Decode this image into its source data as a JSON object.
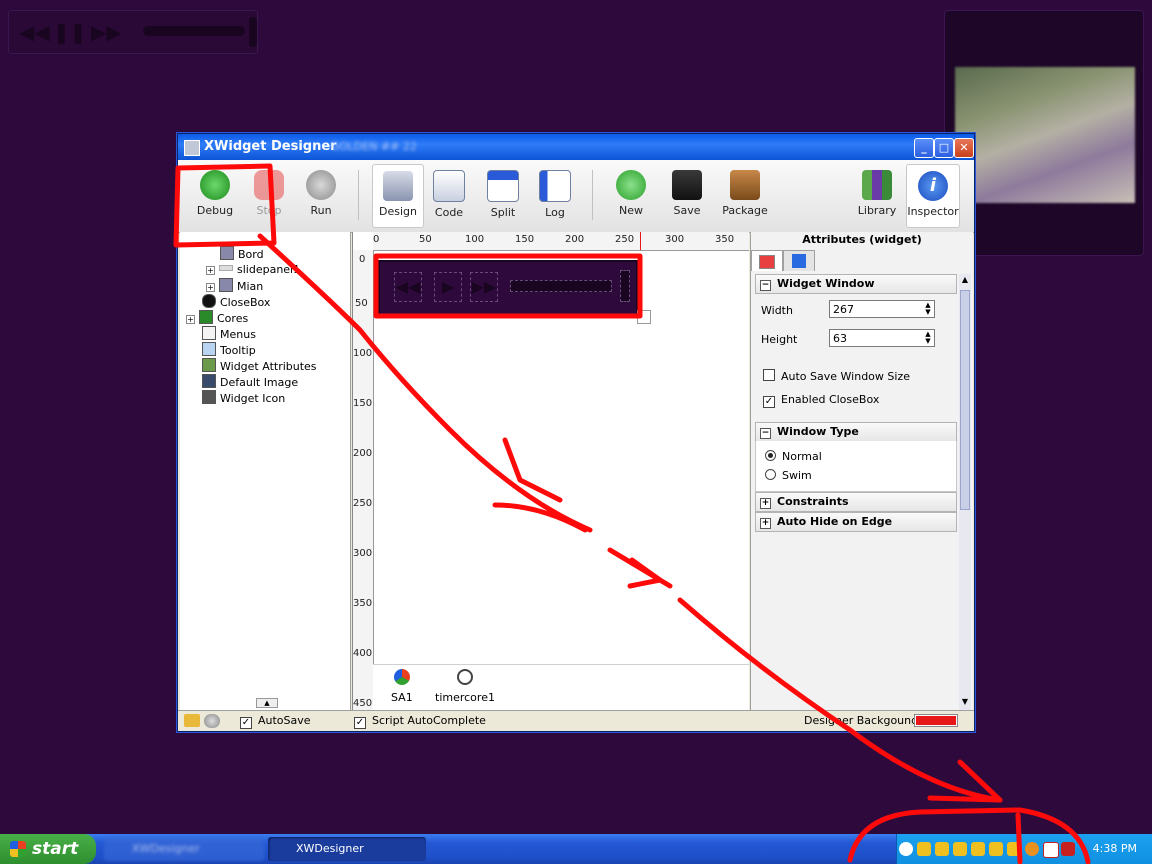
{
  "window": {
    "title": "XWidget Designer",
    "subtitle_blurred": "- GOLDEN ## 22"
  },
  "toolbar": {
    "debug": "Debug",
    "stop": "Stop",
    "run": "Run",
    "design": "Design",
    "code": "Code",
    "split": "Split",
    "log": "Log",
    "new": "New",
    "save": "Save",
    "package": "Package",
    "library": "Library",
    "inspector": "Inspector"
  },
  "tree": {
    "items": [
      {
        "label": "Bord"
      },
      {
        "label": "slidepanel1"
      },
      {
        "label": "Mian"
      },
      {
        "label": "CloseBox"
      },
      {
        "label": "Cores"
      },
      {
        "label": "Menus"
      },
      {
        "label": "Tooltip"
      },
      {
        "label": "Widget Attributes"
      },
      {
        "label": "Default Image"
      },
      {
        "label": "Widget Icon"
      }
    ]
  },
  "ruler": {
    "h": [
      "0",
      "50",
      "100",
      "150",
      "200",
      "250",
      "300",
      "350"
    ],
    "v": [
      "0",
      "50",
      "100",
      "150",
      "200",
      "250",
      "300",
      "350",
      "400",
      "450"
    ]
  },
  "components": [
    {
      "label": "SA1"
    },
    {
      "label": "timercore1"
    }
  ],
  "inspector": {
    "title": "Attributes (widget)",
    "widget_window": "Widget Window",
    "width_label": "Width",
    "width_value": "267",
    "height_label": "Height",
    "height_value": "63",
    "auto_save_size": "Auto Save Window Size",
    "auto_save_size_checked": false,
    "enabled_closebox": "Enabled CloseBox",
    "enabled_closebox_checked": true,
    "window_type": "Window Type",
    "normal": "Normal",
    "swim": "Swim",
    "selected_type": "Normal",
    "constraints": "Constraints",
    "auto_hide": "Auto Hide on Edge"
  },
  "statusbar": {
    "autosave": "AutoSave",
    "script_autocomplete": "Script AutoComplete",
    "designer_background": "Designer Backgound",
    "designer_background_color": "#e81818"
  },
  "taskbar": {
    "start": "start",
    "task_blurred": "XWDesigner",
    "task_active": "XWDesigner",
    "clock": "4:38 PM"
  },
  "colors": {
    "desktop": "#2e0a3c",
    "annotation": "#ff0a0a",
    "title_blue": "#0a5ae8"
  }
}
